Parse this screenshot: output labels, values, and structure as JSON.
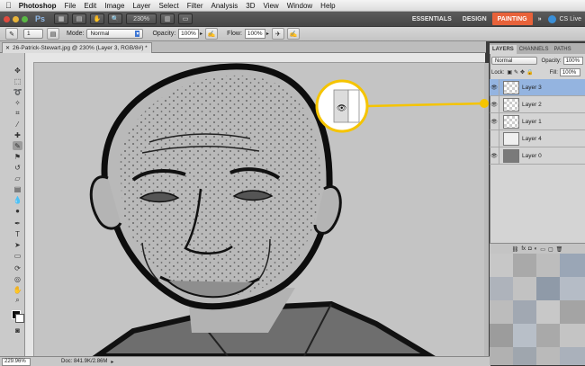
{
  "menubar": {
    "app": "Photoshop",
    "items": [
      "File",
      "Edit",
      "Image",
      "Layer",
      "Select",
      "Filter",
      "Analysis",
      "3D",
      "View",
      "Window",
      "Help"
    ]
  },
  "appbar": {
    "logo": "Ps",
    "zoom": "230%",
    "workspaces": [
      "ESSENTIALS",
      "DESIGN",
      "PAINTING"
    ],
    "active_workspace": "PAINTING",
    "more": "»",
    "cs_live": "CS Live"
  },
  "options": {
    "mode_label": "Mode:",
    "mode_value": "Normal",
    "opacity_label": "Opacity:",
    "opacity_value": "100%",
    "flow_label": "Flow:",
    "flow_value": "100%",
    "brush_size": "1"
  },
  "document": {
    "tab_title": "26-Patrick-Stewart.jpg @ 230% (Layer 3, RGB/8#) *"
  },
  "status": {
    "zoom": "229.96%",
    "doc": "Doc: 841.9K/2.86M"
  },
  "layers_panel": {
    "tabs": [
      "LAYERS",
      "CHANNELS",
      "PATHS"
    ],
    "active_tab": "LAYERS",
    "blend_mode": "Normal",
    "opacity_label": "Opacity:",
    "opacity_value": "100%",
    "lock_label": "Lock:",
    "fill_label": "Fill:",
    "fill_value": "100%",
    "layers": [
      {
        "name": "Layer 3",
        "visible": true,
        "selected": true
      },
      {
        "name": "Layer 2",
        "visible": true,
        "selected": false
      },
      {
        "name": "Layer 1",
        "visible": true,
        "selected": false
      },
      {
        "name": "Layer 4",
        "visible": false,
        "selected": false
      },
      {
        "name": "Layer 0",
        "visible": true,
        "selected": false
      }
    ]
  },
  "colors": {
    "highlight": "#f5c400",
    "selected_layer": "#94b4e0",
    "workspace_active": "#e8623a"
  },
  "icons": {
    "apple": "apple-icon",
    "eye": "eye-icon",
    "cs_live": "cs-live-icon"
  }
}
